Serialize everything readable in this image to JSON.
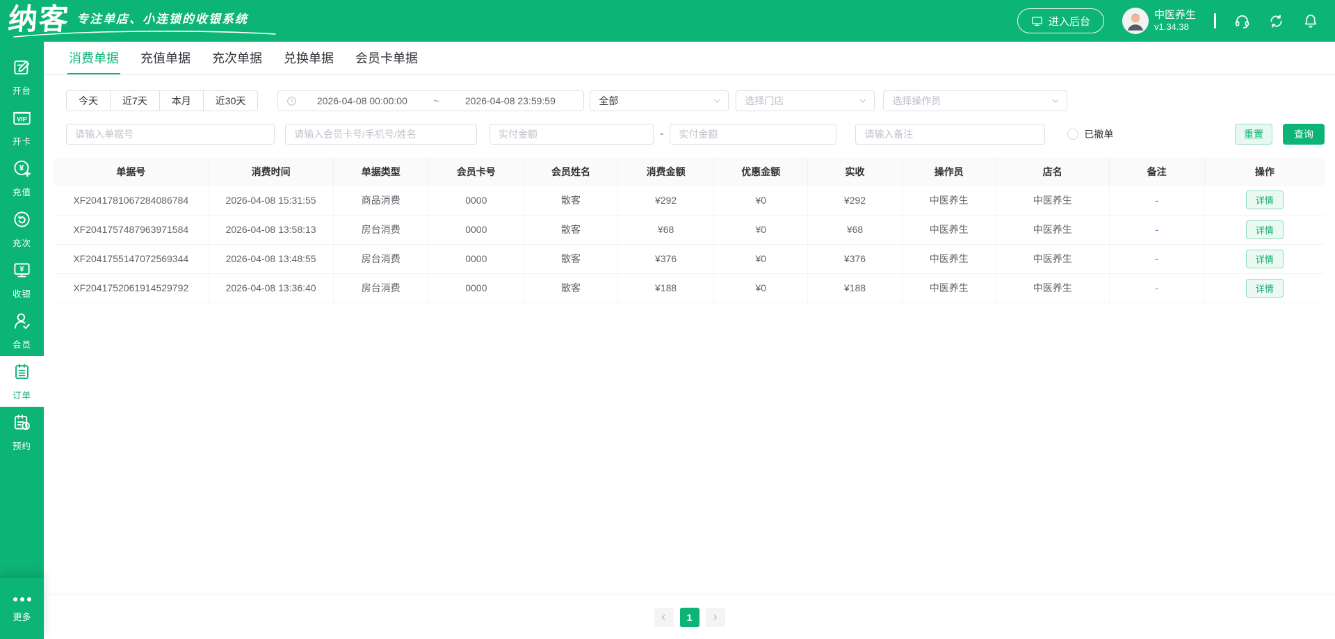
{
  "colors": {
    "brand_green": "#0cb476",
    "reset_button_bg": "#e7f8f1",
    "detail_button_bg": "#eafaf2",
    "table_header_bg": "#fafafa",
    "remark_link_blue": "#4a7dd4"
  },
  "header": {
    "logo": "纳客",
    "tagline": "专注单店、小连锁的收银系统",
    "enter_backend_label": "进入后台",
    "store_name": "中医养生",
    "version": "v1.34.38"
  },
  "sidebar": {
    "items": [
      {
        "id": "open-table",
        "label": "开台",
        "icon": "open-table-icon",
        "active": false
      },
      {
        "id": "open-card",
        "label": "开卡",
        "icon": "vip-card-icon",
        "active": false
      },
      {
        "id": "recharge",
        "label": "充值",
        "icon": "recharge-icon",
        "active": false
      },
      {
        "id": "recharge-times",
        "label": "充次",
        "icon": "recharge-times-icon",
        "active": false
      },
      {
        "id": "cashier",
        "label": "收银",
        "icon": "cashier-icon",
        "active": false
      },
      {
        "id": "member",
        "label": "会员",
        "icon": "member-icon",
        "active": false
      },
      {
        "id": "orders",
        "label": "订单",
        "icon": "orders-icon",
        "active": true
      },
      {
        "id": "booking",
        "label": "预约",
        "icon": "booking-icon",
        "active": false
      }
    ],
    "more_label": "更多"
  },
  "tabs": [
    {
      "id": "consume",
      "label": "消费单据",
      "active": true
    },
    {
      "id": "recharge",
      "label": "充值单据",
      "active": false
    },
    {
      "id": "times",
      "label": "充次单据",
      "active": false
    },
    {
      "id": "exchange",
      "label": "兑换单据",
      "active": false
    },
    {
      "id": "member-card",
      "label": "会员卡单据",
      "active": false
    }
  ],
  "filters": {
    "quick_ranges": [
      "今天",
      "近7天",
      "本月",
      "近30天"
    ],
    "date_start": "2026-04-08 00:00:00",
    "date_separator": "~",
    "date_end": "2026-04-08 23:59:59",
    "type_select_value": "全部",
    "store_select_placeholder": "选择门店",
    "operator_select_placeholder": "选择操作员",
    "bill_no_placeholder": "请输入单据号",
    "member_placeholder": "请输入会员卡号/手机号/姓名",
    "amount_min_placeholder": "实付金额",
    "amount_range_separator": "-",
    "amount_max_placeholder": "实付金额",
    "remark_placeholder": "请输入备注",
    "cancelled_radio_label": "已撤单",
    "reset_label": "重置",
    "query_label": "查询"
  },
  "table": {
    "columns": [
      {
        "label": "单据号",
        "width": "12.2%"
      },
      {
        "label": "消费时间",
        "width": "9.8%"
      },
      {
        "label": "单据类型",
        "width": "7.5%"
      },
      {
        "label": "会员卡号",
        "width": "7.5%"
      },
      {
        "label": "会员姓名",
        "width": "7.4%"
      },
      {
        "label": "消费金额",
        "width": "7.55%"
      },
      {
        "label": "优惠金额",
        "width": "7.4%"
      },
      {
        "label": "实收",
        "width": "7.4%"
      },
      {
        "label": "操作员",
        "width": "7.4%"
      },
      {
        "label": "店名",
        "width": "8.9%"
      },
      {
        "label": "备注",
        "width": "7.5%"
      },
      {
        "label": "操作",
        "width": "9.45%"
      }
    ],
    "action_label": "详情",
    "rows": [
      {
        "bill_no": "XF2041781067284086784",
        "time": "2026-04-08 15:31:55",
        "type": "商品消费",
        "card_no": "0000",
        "member": "散客",
        "amount": "¥292",
        "discount": "¥0",
        "paid": "¥292",
        "operator": "中医养生",
        "store": "中医养生",
        "remark": "-"
      },
      {
        "bill_no": "XF2041757487963971584",
        "time": "2026-04-08 13:58:13",
        "type": "房台消费",
        "card_no": "0000",
        "member": "散客",
        "amount": "¥68",
        "discount": "¥0",
        "paid": "¥68",
        "operator": "中医养生",
        "store": "中医养生",
        "remark": "-"
      },
      {
        "bill_no": "XF2041755147072569344",
        "time": "2026-04-08 13:48:55",
        "type": "房台消费",
        "card_no": "0000",
        "member": "散客",
        "amount": "¥376",
        "discount": "¥0",
        "paid": "¥376",
        "operator": "中医养生",
        "store": "中医养生",
        "remark": "-"
      },
      {
        "bill_no": "XF2041752061914529792",
        "time": "2026-04-08 13:36:40",
        "type": "房台消费",
        "card_no": "0000",
        "member": "散客",
        "amount": "¥188",
        "discount": "¥0",
        "paid": "¥188",
        "operator": "中医养生",
        "store": "中医养生",
        "remark": "-"
      }
    ]
  },
  "pagination": {
    "prev": "‹",
    "current": "1",
    "next": "›"
  }
}
